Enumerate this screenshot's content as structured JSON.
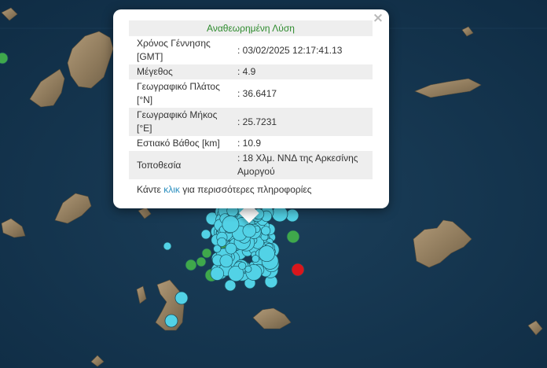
{
  "popup": {
    "title": "Αναθεωρημένη Λύση",
    "rows": [
      {
        "label": "Χρόνος Γέννησης [GMT]",
        "value": ": 03/02/2025 12:17:41.13"
      },
      {
        "label": "Μέγεθος",
        "value": ": 4.9"
      },
      {
        "label": "Γεωγραφικό Πλάτος [°N]",
        "value": ": 36.6417"
      },
      {
        "label": "Γεωγραφικό Μήκος [°E]",
        "value": ": 25.7231"
      },
      {
        "label": "Εστιακό Βάθος [km]",
        "value": ": 10.9"
      },
      {
        "label": "Τοποθεσία",
        "value": ": 18 Χλμ. ΝΝΔ της Αρκεσίνης Αμοργού"
      }
    ],
    "more_prefix": "Κάντε ",
    "more_link": "κλικ",
    "more_suffix": " για περισσότερες πληροφορίες",
    "close_symbol": "×"
  },
  "map": {
    "sea_color": "#13344e",
    "land_color": "#9a8566",
    "quake_colors": {
      "recent": "#52d2e6",
      "older": "#3fa84b",
      "latest": "#d9161c"
    }
  }
}
